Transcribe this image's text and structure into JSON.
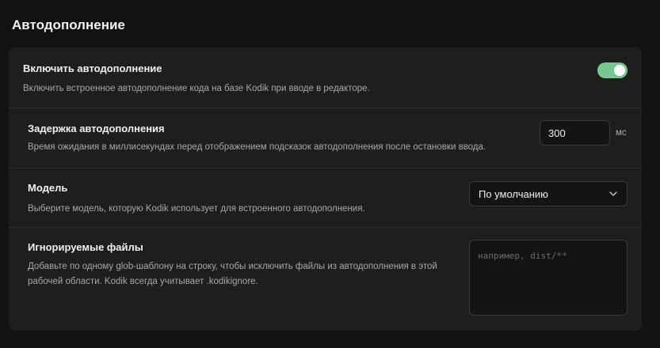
{
  "page": {
    "title": "Автодополнение"
  },
  "settings": {
    "enable": {
      "label": "Включить автодополнение",
      "description": "Включить встроенное автодополнение кода на базе Kodik при вводе в редакторе.",
      "enabled": true
    },
    "delay": {
      "label": "Задержка автодополнения",
      "description": "Время ожидания в миллисекундах перед отображением подсказок автодополнения после остановки ввода.",
      "value": "300",
      "unit": "мс"
    },
    "model": {
      "label": "Модель",
      "description": "Выберите модель, которую Kodik использует для встроенного автодополнения.",
      "selected": "По умолчанию",
      "dropdown_icon": "chevron-down-icon"
    },
    "ignore": {
      "label": "Игнорируемые файлы",
      "description_line1": "Добавьте по одному glob-шаблону на строку, чтобы исключить файлы из автодополнения в этой",
      "description_line2": "рабочей области. Kodik всегда учитывает .kodikignore.",
      "placeholder": "например, dist/**"
    }
  },
  "colors": {
    "background": "#121212",
    "panel": "#1e1e1e",
    "toggle_on": "#78c690"
  }
}
